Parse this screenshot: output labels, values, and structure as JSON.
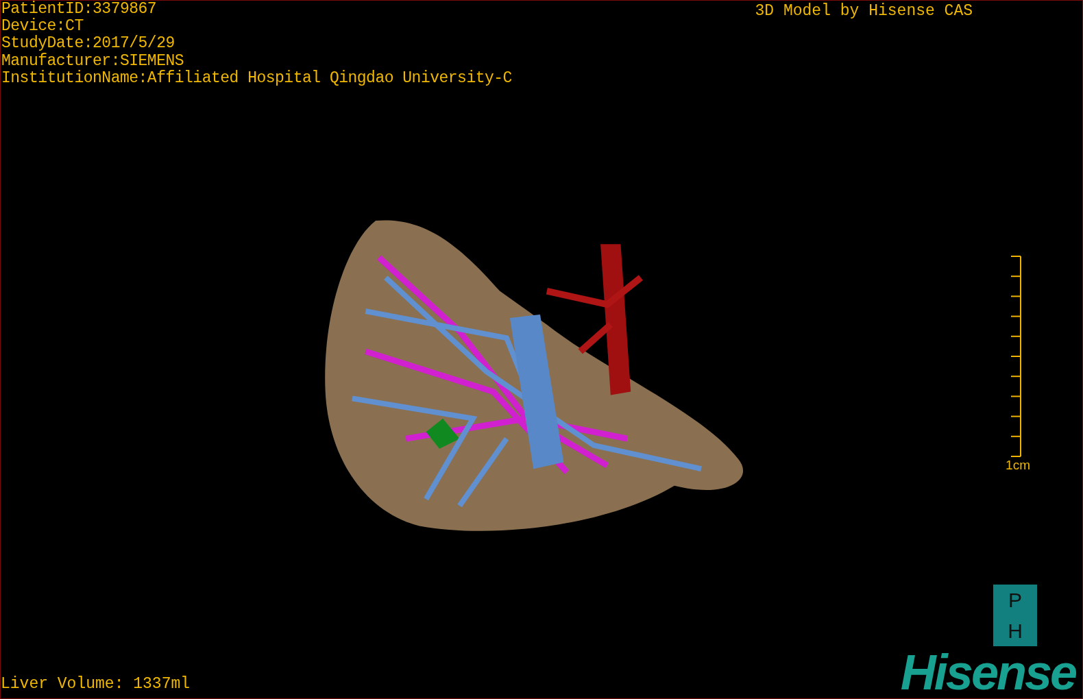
{
  "study_info": [
    "PatientID:3379867",
    "Device:CT",
    "StudyDate:2017/5/29",
    "Manufacturer:SIEMENS",
    "InstitutionName:Affiliated Hospital Qingdao University-C"
  ],
  "model_title": "3D Model by Hisense CAS",
  "scale_bar": {
    "label": "1cm"
  },
  "liver_volume": "Liver Volume: 1337ml",
  "logo": {
    "badge_top": "P",
    "badge_bottom": "H",
    "wordmark": "Hisense"
  }
}
